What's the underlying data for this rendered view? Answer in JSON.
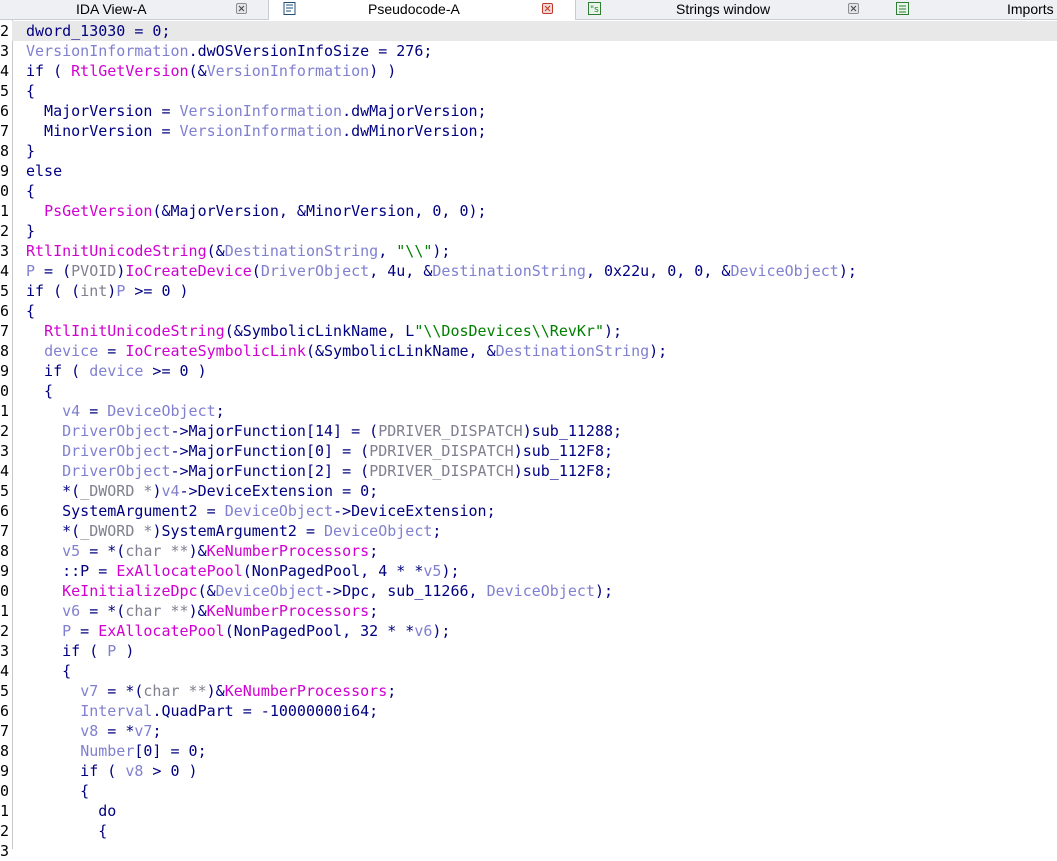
{
  "tabs": [
    {
      "label": "IDA View-A",
      "icon": "ida-view-icon",
      "active": false
    },
    {
      "label": "Pseudocode-A",
      "icon": "pseudocode-icon",
      "active": true
    },
    {
      "label": "Strings window",
      "icon": "strings-icon",
      "active": false
    },
    {
      "label": "Imports",
      "icon": "imports-icon",
      "active": false
    }
  ],
  "gutter_digits": [
    "2",
    "3",
    "4",
    "5",
    "6",
    "7",
    "8",
    "9",
    "0",
    "1",
    "2",
    "3",
    "4",
    "5",
    "6",
    "7",
    "8",
    "9",
    "0",
    "1",
    "2",
    "3",
    "4",
    "5",
    "6",
    "7",
    "8",
    "9",
    "0",
    "1",
    "2",
    "3",
    "4",
    "5",
    "6",
    "7",
    "8",
    "9",
    "0",
    "1",
    "2",
    "3"
  ],
  "code_lines": [
    [
      [
        "pl",
        "dword_13030 = 0;"
      ]
    ],
    [
      [
        "gv",
        "VersionInformation"
      ],
      [
        "pl",
        ".dwOSVersionInfoSize = 276;"
      ]
    ],
    [
      [
        "kw",
        "if ( "
      ],
      [
        "fn",
        "RtlGetVersion"
      ],
      [
        "pl",
        "(&"
      ],
      [
        "gv",
        "VersionInformation"
      ],
      [
        "pl",
        ") )"
      ]
    ],
    [
      [
        "pl",
        "{"
      ]
    ],
    [
      [
        "pl",
        "  MajorVersion = "
      ],
      [
        "gv",
        "VersionInformation"
      ],
      [
        "pl",
        ".dwMajorVersion;"
      ]
    ],
    [
      [
        "pl",
        "  MinorVersion = "
      ],
      [
        "gv",
        "VersionInformation"
      ],
      [
        "pl",
        ".dwMinorVersion;"
      ]
    ],
    [
      [
        "pl",
        "}"
      ]
    ],
    [
      [
        "kw",
        "else"
      ]
    ],
    [
      [
        "pl",
        "{"
      ]
    ],
    [
      [
        "pl",
        "  "
      ],
      [
        "fn",
        "PsGetVersion"
      ],
      [
        "pl",
        "(&MajorVersion, &MinorVersion, 0, 0);"
      ]
    ],
    [
      [
        "pl",
        "}"
      ]
    ],
    [
      [
        "fn",
        "RtlInitUnicodeString"
      ],
      [
        "pl",
        "(&"
      ],
      [
        "gv",
        "DestinationString"
      ],
      [
        "pl",
        ", "
      ],
      [
        "str",
        "\"\\\\\""
      ],
      [
        "pl",
        ");"
      ]
    ],
    [
      [
        "gv",
        "P"
      ],
      [
        "pl",
        " = ("
      ],
      [
        "ty",
        "PVOID"
      ],
      [
        "pl",
        ")"
      ],
      [
        "fn",
        "IoCreateDevice"
      ],
      [
        "pl",
        "("
      ],
      [
        "gv",
        "DriverObject"
      ],
      [
        "pl",
        ", 4u, &"
      ],
      [
        "gv",
        "DestinationString"
      ],
      [
        "pl",
        ", 0x22u, 0, 0, &"
      ],
      [
        "gv",
        "DeviceObject"
      ],
      [
        "pl",
        ");"
      ]
    ],
    [
      [
        "kw",
        "if ( ("
      ],
      [
        "ty",
        "int"
      ],
      [
        "pl",
        ")"
      ],
      [
        "gv",
        "P"
      ],
      [
        "pl",
        " >= 0 )"
      ]
    ],
    [
      [
        "pl",
        "{"
      ]
    ],
    [
      [
        "pl",
        "  "
      ],
      [
        "fn",
        "RtlInitUnicodeString"
      ],
      [
        "pl",
        "(&SymbolicLinkName, L"
      ],
      [
        "str",
        "\"\\\\DosDevices\\\\RevKr\""
      ],
      [
        "pl",
        ");"
      ]
    ],
    [
      [
        "pl",
        "  "
      ],
      [
        "gv",
        "device"
      ],
      [
        "pl",
        " = "
      ],
      [
        "fn",
        "IoCreateSymbolicLink"
      ],
      [
        "pl",
        "(&SymbolicLinkName, &"
      ],
      [
        "gv",
        "DestinationString"
      ],
      [
        "pl",
        ");"
      ]
    ],
    [
      [
        "kw",
        "  if ( "
      ],
      [
        "gv",
        "device"
      ],
      [
        "pl",
        " >= 0 )"
      ]
    ],
    [
      [
        "pl",
        "  {"
      ]
    ],
    [
      [
        "pl",
        "    "
      ],
      [
        "gv",
        "v4"
      ],
      [
        "pl",
        " = "
      ],
      [
        "gv",
        "DeviceObject"
      ],
      [
        "pl",
        ";"
      ]
    ],
    [
      [
        "pl",
        "    "
      ],
      [
        "gv",
        "DriverObject"
      ],
      [
        "pl",
        "->MajorFunction[14] = ("
      ],
      [
        "ty",
        "PDRIVER_DISPATCH"
      ],
      [
        "pl",
        ")sub_11288;"
      ]
    ],
    [
      [
        "pl",
        "    "
      ],
      [
        "gv",
        "DriverObject"
      ],
      [
        "pl",
        "->MajorFunction[0] = ("
      ],
      [
        "ty",
        "PDRIVER_DISPATCH"
      ],
      [
        "pl",
        ")sub_112F8;"
      ]
    ],
    [
      [
        "pl",
        "    "
      ],
      [
        "gv",
        "DriverObject"
      ],
      [
        "pl",
        "->MajorFunction[2] = ("
      ],
      [
        "ty",
        "PDRIVER_DISPATCH"
      ],
      [
        "pl",
        ")sub_112F8;"
      ]
    ],
    [
      [
        "pl",
        "    *("
      ],
      [
        "ty",
        "_DWORD *"
      ],
      [
        "pl",
        ")"
      ],
      [
        "gv",
        "v4"
      ],
      [
        "pl",
        "->DeviceExtension = 0;"
      ]
    ],
    [
      [
        "pl",
        "    SystemArgument2 = "
      ],
      [
        "gv",
        "DeviceObject"
      ],
      [
        "pl",
        "->DeviceExtension;"
      ]
    ],
    [
      [
        "pl",
        "    *("
      ],
      [
        "ty",
        "_DWORD *"
      ],
      [
        "pl",
        ")SystemArgument2 = "
      ],
      [
        "gv",
        "DeviceObject"
      ],
      [
        "pl",
        ";"
      ]
    ],
    [
      [
        "pl",
        "    "
      ],
      [
        "gv",
        "v5"
      ],
      [
        "pl",
        " = *("
      ],
      [
        "ty",
        "char **"
      ],
      [
        "pl",
        ")&"
      ],
      [
        "fn",
        "KeNumberProcessors"
      ],
      [
        "pl",
        ";"
      ]
    ],
    [
      [
        "pl",
        "    ::P = "
      ],
      [
        "fn",
        "ExAllocatePool"
      ],
      [
        "pl",
        "(NonPagedPool, 4 * *"
      ],
      [
        "gv",
        "v5"
      ],
      [
        "pl",
        ");"
      ]
    ],
    [
      [
        "pl",
        "    "
      ],
      [
        "fn",
        "KeInitializeDpc"
      ],
      [
        "pl",
        "(&"
      ],
      [
        "gv",
        "DeviceObject"
      ],
      [
        "pl",
        "->Dpc, sub_11266, "
      ],
      [
        "gv",
        "DeviceObject"
      ],
      [
        "pl",
        ");"
      ]
    ],
    [
      [
        "pl",
        "    "
      ],
      [
        "gv",
        "v6"
      ],
      [
        "pl",
        " = *("
      ],
      [
        "ty",
        "char **"
      ],
      [
        "pl",
        ")&"
      ],
      [
        "fn",
        "KeNumberProcessors"
      ],
      [
        "pl",
        ";"
      ]
    ],
    [
      [
        "pl",
        "    "
      ],
      [
        "gv",
        "P"
      ],
      [
        "pl",
        " = "
      ],
      [
        "fn",
        "ExAllocatePool"
      ],
      [
        "pl",
        "(NonPagedPool, 32 * *"
      ],
      [
        "gv",
        "v6"
      ],
      [
        "pl",
        ");"
      ]
    ],
    [
      [
        "kw",
        "    if ( "
      ],
      [
        "gv",
        "P"
      ],
      [
        "pl",
        " )"
      ]
    ],
    [
      [
        "pl",
        "    {"
      ]
    ],
    [
      [
        "pl",
        "      "
      ],
      [
        "gv",
        "v7"
      ],
      [
        "pl",
        " = *("
      ],
      [
        "ty",
        "char **"
      ],
      [
        "pl",
        ")&"
      ],
      [
        "fn",
        "KeNumberProcessors"
      ],
      [
        "pl",
        ";"
      ]
    ],
    [
      [
        "pl",
        "      "
      ],
      [
        "gv",
        "Interval"
      ],
      [
        "pl",
        ".QuadPart = -10000000i64;"
      ]
    ],
    [
      [
        "pl",
        "      "
      ],
      [
        "gv",
        "v8"
      ],
      [
        "pl",
        " = *"
      ],
      [
        "gv",
        "v7"
      ],
      [
        "pl",
        ";"
      ]
    ],
    [
      [
        "pl",
        "      "
      ],
      [
        "gv",
        "Number"
      ],
      [
        "pl",
        "[0] = 0;"
      ]
    ],
    [
      [
        "kw",
        "      if ( "
      ],
      [
        "gv",
        "v8"
      ],
      [
        "pl",
        " > 0 )"
      ]
    ],
    [
      [
        "pl",
        "      {"
      ]
    ],
    [
      [
        "kw",
        "        do"
      ]
    ],
    [
      [
        "pl",
        "        {"
      ]
    ],
    [
      [
        "pl",
        "          "
      ]
    ]
  ],
  "colors": {
    "plain": "#000080",
    "global": "#8080d0",
    "function": "#d000d0",
    "type": "#808090",
    "string": "#008000",
    "highlight_line": "#e8e8e8"
  }
}
